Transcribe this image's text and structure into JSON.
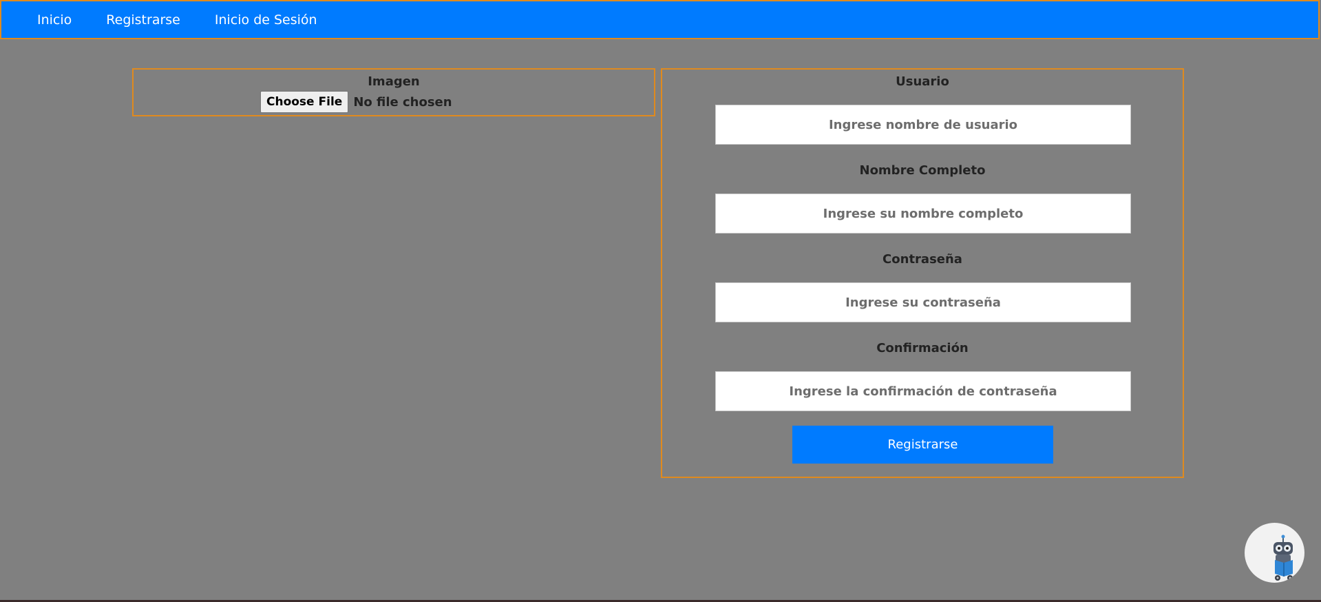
{
  "nav": {
    "items": [
      {
        "label": "Inicio"
      },
      {
        "label": "Registrarse"
      },
      {
        "label": "Inicio de Sesión"
      }
    ]
  },
  "image_section": {
    "label": "Imagen",
    "file_button_label": "Choose File",
    "file_status": "No file chosen"
  },
  "form": {
    "username_label": "Usuario",
    "username_placeholder": "Ingrese nombre de usuario",
    "fullname_label": "Nombre Completo",
    "fullname_placeholder": "Ingrese su nombre completo",
    "password_label": "Contraseña",
    "password_placeholder": "Ingrese su contraseña",
    "confirm_label": "Confirmación",
    "confirm_placeholder": "Ingrese la confirmación de contraseña",
    "submit_label": "Registrarse"
  },
  "colors": {
    "primary": "#007bff",
    "panel_border": "#e08a1e",
    "background": "#808080"
  },
  "chat_widget": {
    "icon": "robot-reading-icon"
  }
}
